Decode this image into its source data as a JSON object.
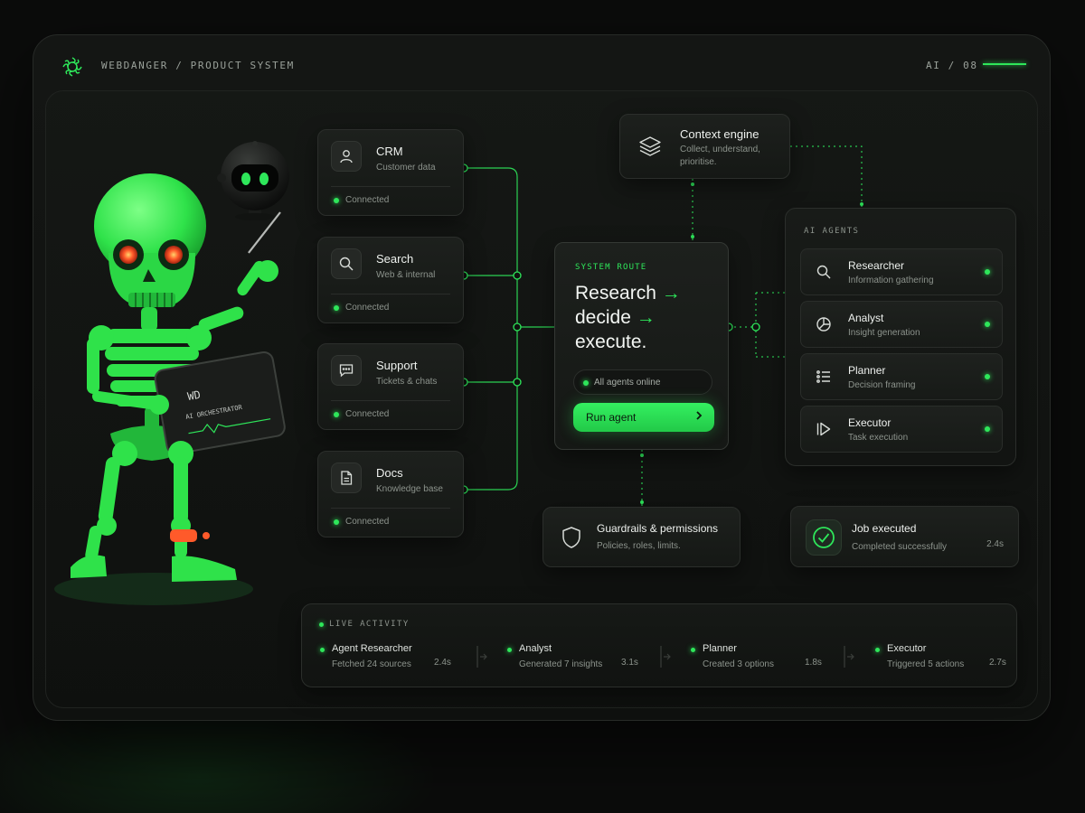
{
  "header": {
    "brand": "WEBDANGER / PRODUCT SYSTEM",
    "page_indicator": "AI / 08"
  },
  "colors": {
    "accent": "#2ee65a",
    "background": "#0b0c0b",
    "card": "#1a1d1a",
    "alert_orange": "#ff5a2a"
  },
  "sources": [
    {
      "title": "CRM",
      "subtitle": "Customer data",
      "status": "Connected",
      "icon": "user-icon"
    },
    {
      "title": "Search",
      "subtitle": "Web & internal",
      "status": "Connected",
      "icon": "search-icon"
    },
    {
      "title": "Support",
      "subtitle": "Tickets & chats",
      "status": "Connected",
      "icon": "chat-icon"
    },
    {
      "title": "Docs",
      "subtitle": "Knowledge base",
      "status": "Connected",
      "icon": "document-icon"
    }
  ],
  "context_engine": {
    "title": "Context engine",
    "subtitle": "Collect, understand, prioritise.",
    "icon": "layers-icon"
  },
  "route": {
    "label": "SYSTEM ROUTE",
    "line1": "Research",
    "line2": "decide",
    "line3": "execute.",
    "arrow": "→",
    "status": "All agents online",
    "button_label": "Run agent",
    "button_icon": "chevron-right-icon"
  },
  "agents": {
    "label": "AI AGENTS",
    "items": [
      {
        "name": "Researcher",
        "desc": "Information gathering",
        "icon": "search-icon"
      },
      {
        "name": "Analyst",
        "desc": "Insight generation",
        "icon": "pie-chart-icon"
      },
      {
        "name": "Planner",
        "desc": "Decision framing",
        "icon": "list-icon"
      },
      {
        "name": "Executor",
        "desc": "Task execution",
        "icon": "play-forward-icon"
      }
    ]
  },
  "guardrails": {
    "title": "Guardrails & permissions",
    "subtitle": "Policies, roles, limits.",
    "icon": "shield-icon"
  },
  "job": {
    "title": "Job executed",
    "subtitle": "Completed successfully",
    "time": "2.4s",
    "icon": "check-circle-icon"
  },
  "activity": {
    "label": "LIVE ACTIVITY",
    "items": [
      {
        "name": "Agent Researcher",
        "desc": "Fetched 24 sources",
        "time": "2.4s"
      },
      {
        "name": "Analyst",
        "desc": "Generated 7 insights",
        "time": "3.1s"
      },
      {
        "name": "Planner",
        "desc": "Created 3 options",
        "time": "1.8s"
      },
      {
        "name": "Executor",
        "desc": "Triggered 5 actions",
        "time": "2.7s"
      }
    ]
  },
  "illustration": {
    "tablet_logo": "WD",
    "tablet_caption": "AI ORCHESTRATOR"
  }
}
